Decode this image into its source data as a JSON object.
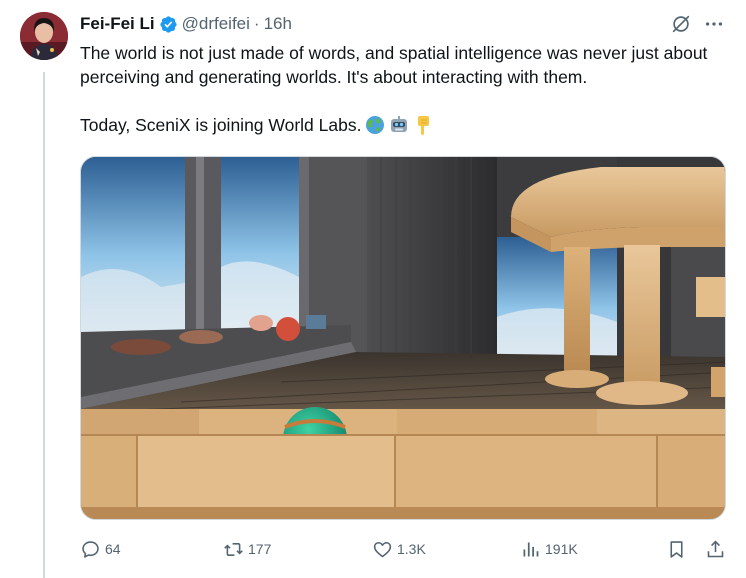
{
  "tweet": {
    "author": {
      "name": "Fei-Fei Li",
      "handle": "@drfeifei",
      "separator": "·",
      "time": "16h"
    },
    "text_line1": "The world is not just made of words, and spatial intelligence was never just about perceiving and generating worlds. It's about interacting with them.",
    "text_line2": "Today, SceniX is joining World Labs.",
    "emojis": [
      "globe-emoji",
      "robot-emoji",
      "pointing-down-emoji"
    ],
    "media": {
      "kind": "image",
      "scene": "3d-room-with-window-and-wooden-table"
    }
  },
  "actions": {
    "replies": "64",
    "reposts": "177",
    "likes": "1.3K",
    "views": "191K"
  },
  "colors": {
    "text": "#0f1419",
    "muted": "#536471",
    "verified": "#1d9bf0",
    "border": "#cfd9de"
  }
}
